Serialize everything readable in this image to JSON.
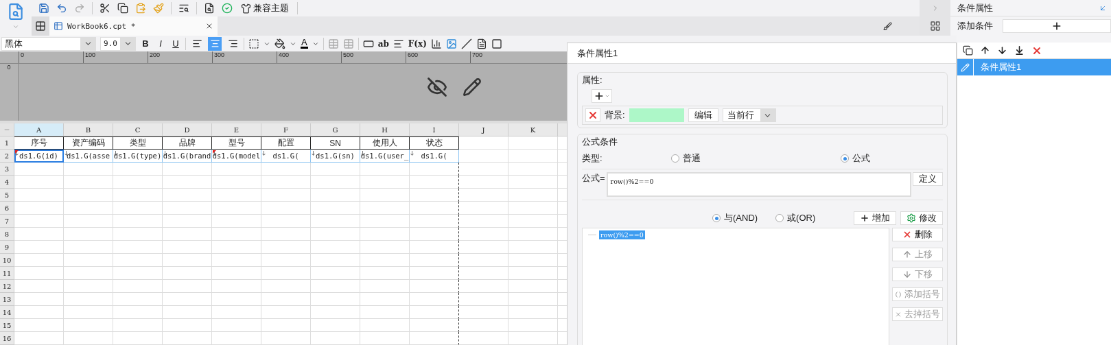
{
  "toolbar": {
    "theme_button": "兼容主题"
  },
  "tabs": [
    {
      "label": "WorkBook6.cpt *",
      "selected": true
    }
  ],
  "format_bar": {
    "font": "黑体",
    "size": "9.0",
    "style_buttons": [
      "B",
      "I",
      "U"
    ],
    "align_buttons": [
      {
        "selected": false
      },
      {
        "selected": true
      },
      {
        "selected": false
      }
    ],
    "font_color_glyph": "A",
    "text_buttons": [
      "ab",
      "F(x)"
    ]
  },
  "ruler": {
    "marks": [
      "0",
      "100",
      "200",
      "300",
      "400",
      "500",
      "600",
      "700"
    ],
    "vertical_mark": "0"
  },
  "sheet": {
    "columns": [
      {
        "label": "A",
        "selected": true
      },
      {
        "label": "B",
        "selected": false
      },
      {
        "label": "C",
        "selected": false
      },
      {
        "label": "D",
        "selected": false
      },
      {
        "label": "E",
        "selected": false
      },
      {
        "label": "F",
        "selected": false
      },
      {
        "label": "G",
        "selected": false
      },
      {
        "label": "H",
        "selected": false
      },
      {
        "label": "I",
        "selected": false
      },
      {
        "label": "J",
        "selected": false
      },
      {
        "label": "K",
        "selected": false
      }
    ],
    "rows": [
      {
        "number": "1",
        "kind": "header",
        "cells": [
          {
            "text": "序号",
            "selected": false
          },
          {
            "text": "资产编码",
            "selected": false
          },
          {
            "text": "类型",
            "selected": false
          },
          {
            "text": "品牌",
            "selected": false
          },
          {
            "text": "型号",
            "selected": false
          },
          {
            "text": "配置",
            "selected": false
          },
          {
            "text": "SN",
            "selected": false
          },
          {
            "text": "使用人",
            "selected": false
          },
          {
            "text": "状态",
            "selected": false
          }
        ]
      },
      {
        "number": "2",
        "kind": "data",
        "cells": [
          {
            "text": "ds1.G(id)",
            "selected": true,
            "flagged": true
          },
          {
            "text": "ds1.G(asse",
            "selected": false,
            "flagged": false
          },
          {
            "text": "ds1.G(type)",
            "selected": false,
            "flagged": false
          },
          {
            "text": "ds1.G(brand",
            "selected": false,
            "flagged": false
          },
          {
            "text": "ds1.G(model",
            "selected": false,
            "flagged": true
          },
          {
            "text": "ds1.G(",
            "selected": false,
            "flagged": false
          },
          {
            "text": "ds1.G(sn)",
            "selected": false,
            "flagged": false
          },
          {
            "text": "ds1.G(user_",
            "selected": false,
            "flagged": false
          },
          {
            "text": "ds1.G(",
            "selected": false,
            "flagged": false
          }
        ]
      },
      {
        "number": "3",
        "kind": "empty"
      },
      {
        "number": "4",
        "kind": "empty"
      },
      {
        "number": "5",
        "kind": "empty"
      },
      {
        "number": "6",
        "kind": "empty"
      },
      {
        "number": "7",
        "kind": "empty"
      },
      {
        "number": "8",
        "kind": "empty"
      },
      {
        "number": "9",
        "kind": "empty"
      },
      {
        "number": "10",
        "kind": "empty"
      },
      {
        "number": "11",
        "kind": "empty"
      },
      {
        "number": "12",
        "kind": "empty"
      },
      {
        "number": "13",
        "kind": "empty"
      },
      {
        "number": "14",
        "kind": "empty"
      },
      {
        "number": "15",
        "kind": "empty"
      },
      {
        "number": "16",
        "kind": "empty"
      }
    ]
  },
  "dialog": {
    "title": "条件属性1",
    "attributes": {
      "legend": "属性:",
      "background_label": "背景:",
      "color": "#adf7c8",
      "edit_button": "编辑",
      "scope": "当前行"
    },
    "formula_condition": {
      "legend": "公式条件",
      "type_label": "类型:",
      "types": [
        {
          "label": "普通",
          "selected": false
        },
        {
          "label": "公式",
          "selected": true
        }
      ],
      "formula_label": "公式=",
      "formula": "row()%2==0",
      "define_button": "定义",
      "joins": [
        {
          "label": "与(AND)",
          "selected": true
        },
        {
          "label": "或(OR)",
          "selected": false
        }
      ],
      "add_button": "增加",
      "modify_button": "修改",
      "conditions": [
        {
          "text": "row()%2==0",
          "selected": true
        }
      ],
      "side_buttons": [
        {
          "label": "删除",
          "kind": "delete",
          "disabled": false
        },
        {
          "label": "上移",
          "kind": "up",
          "disabled": true
        },
        {
          "label": "下移",
          "kind": "down",
          "disabled": true
        },
        {
          "label": "添加括号",
          "kind": "add-paren",
          "disabled": true
        },
        {
          "label": "去掉括号",
          "kind": "remove-paren",
          "disabled": true
        }
      ]
    }
  },
  "panel": {
    "title": "条件属性",
    "add_label": "添加条件",
    "items": [
      {
        "label": "条件属性1",
        "selected": true
      }
    ]
  }
}
